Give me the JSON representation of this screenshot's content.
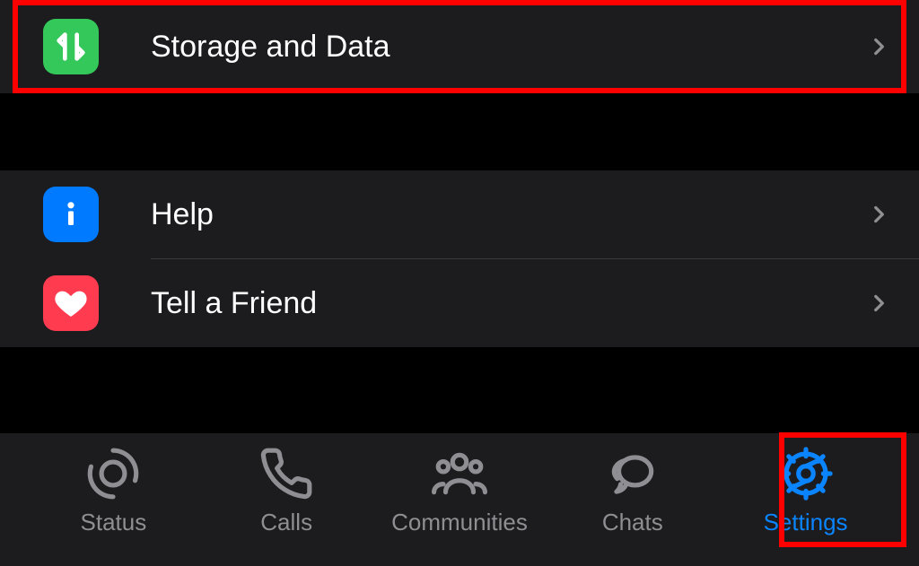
{
  "items": {
    "storage": {
      "label": "Storage and Data"
    },
    "help": {
      "label": "Help"
    },
    "tell": {
      "label": "Tell a Friend"
    }
  },
  "tabs": {
    "status": {
      "label": "Status"
    },
    "calls": {
      "label": "Calls"
    },
    "communities": {
      "label": "Communities"
    },
    "chats": {
      "label": "Chats"
    },
    "settings": {
      "label": "Settings"
    }
  },
  "colors": {
    "accent": "#0a84ff",
    "highlight": "#ff0000"
  }
}
